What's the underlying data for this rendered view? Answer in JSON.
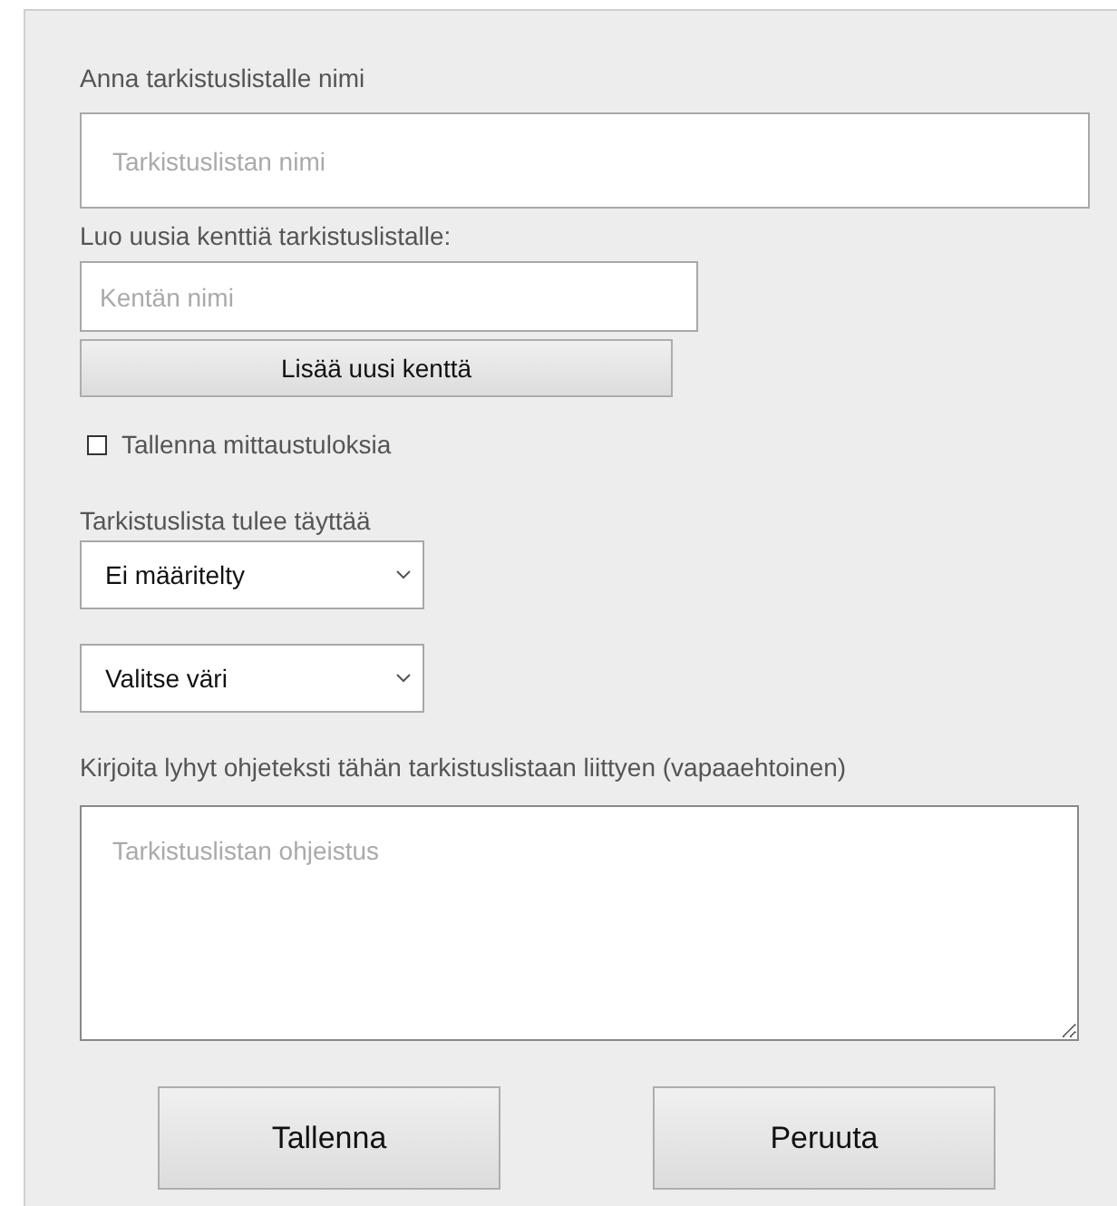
{
  "name_section": {
    "label": "Anna tarkistuslistalle nimi",
    "placeholder": "Tarkistuslistan nimi"
  },
  "fields_section": {
    "label": "Luo uusia kenttiä tarkistuslistalle:",
    "placeholder": "Kentän nimi",
    "add_button": "Lisää uusi kenttä"
  },
  "save_measurements": {
    "label": "Tallenna mittaustuloksia",
    "checked": false
  },
  "fill_section": {
    "label": "Tarkistuslista tulee täyttää",
    "value": "Ei määritelty"
  },
  "color_select": {
    "value": "Valitse väri"
  },
  "instructions": {
    "label": "Kirjoita lyhyt ohjeteksti tähän tarkistuslistaan liittyen (vapaaehtoinen)",
    "placeholder": "Tarkistuslistan ohjeistus"
  },
  "buttons": [
    "Tallenna",
    "Peruuta"
  ]
}
